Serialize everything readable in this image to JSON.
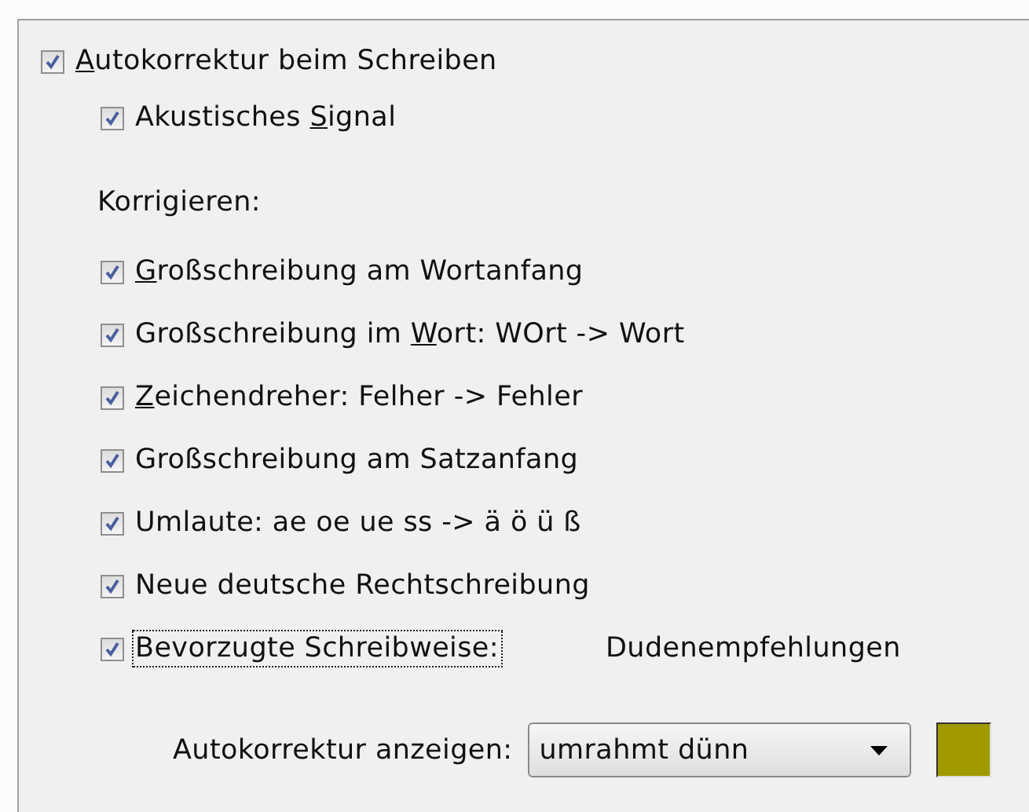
{
  "autocorrect": {
    "accesskey": "A",
    "label_after": "utokorrektur beim Schreiben",
    "checked": true
  },
  "acoustic_signal": {
    "label_before": "Akustisches ",
    "accesskey": "S",
    "label_after": "ignal",
    "checked": true
  },
  "correct_heading": "Korrigieren:",
  "corrections": [
    {
      "accesskey": "G",
      "label_after": "roßschreibung am Wortanfang",
      "checked": true,
      "focused": false
    },
    {
      "label_before": "Großschreibung im ",
      "accesskey": "W",
      "label_after": "ort: WOrt -> Wort",
      "checked": true,
      "focused": false
    },
    {
      "accesskey": "Z",
      "label_after": "eichendreher: Felher -> Fehler",
      "checked": true,
      "focused": false
    },
    {
      "label_before": "Großschreibung am Satzanfang",
      "checked": true,
      "focused": false
    },
    {
      "label_before": "Umlaute: ae oe ue ss -> ä ö ü ß",
      "checked": true,
      "focused": false
    },
    {
      "label_before": "Neue deutsche Rechtschreibung",
      "checked": true,
      "focused": false
    },
    {
      "label_before": "Bevorzugte Schreibweise:",
      "checked": true,
      "focused": true,
      "value": "Dudenempfehlungen"
    }
  ],
  "display": {
    "label": "Autokorrektur anzeigen:",
    "dropdown_value": "umrahmt dünn",
    "color": "#a09a00"
  }
}
